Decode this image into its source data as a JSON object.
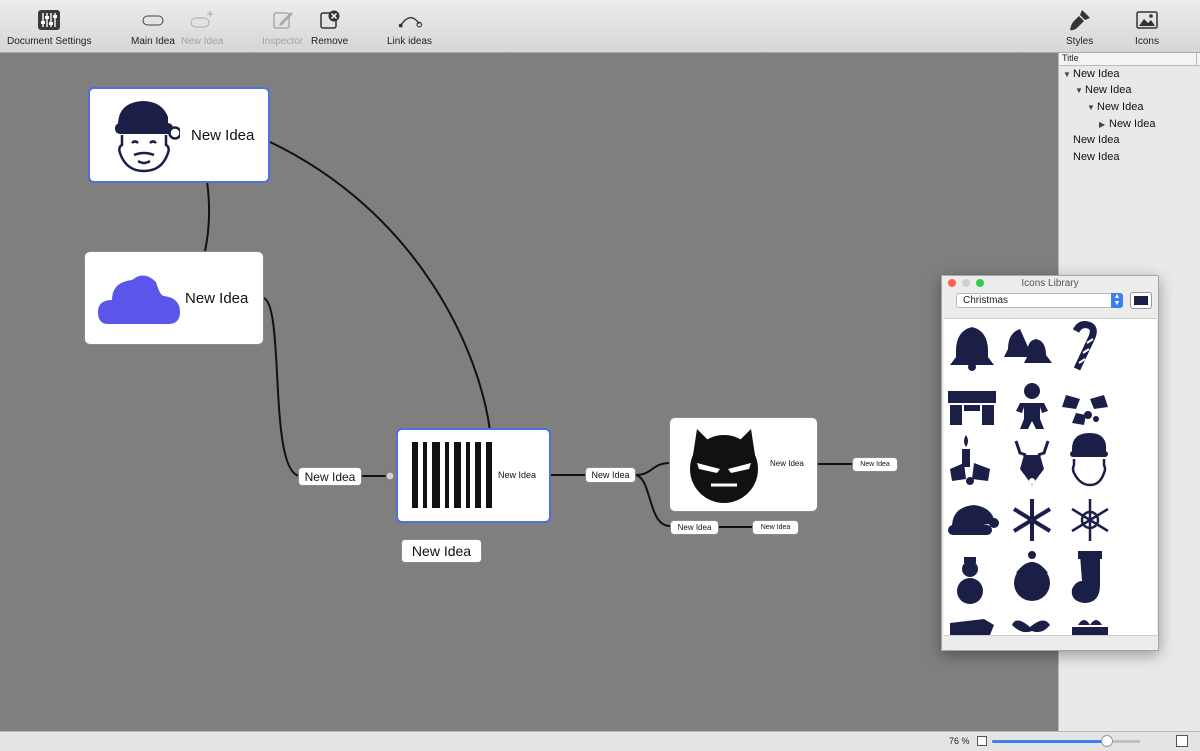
{
  "toolbar": {
    "document_settings": "Document Settings",
    "main_idea": "Main Idea",
    "new_idea": "New Idea",
    "inspector": "Inspector",
    "remove": "Remove",
    "link_ideas": "Link ideas",
    "styles": "Styles",
    "icons": "Icons"
  },
  "canvas": {
    "nodes": {
      "santa": "New Idea",
      "cloud": "New Idea",
      "barcode": "New Idea",
      "batman": "New Idea"
    },
    "pills": {
      "left": "New Idea",
      "below_barcode": "New Idea",
      "mid": "New Idea",
      "right": "New Idea",
      "bottom_a": "New Idea",
      "bottom_b": "New Idea"
    }
  },
  "outline": {
    "column_title": "Title",
    "rows": [
      "New Idea",
      "New Idea",
      "New Idea",
      "New Idea",
      "New Idea",
      "New Idea"
    ]
  },
  "status": {
    "zoom": "76 %",
    "zoom_fraction": 0.78
  },
  "icons_library": {
    "title": "Icons Library",
    "category": "Christmas",
    "icon_color": "#1b1f48",
    "icons": [
      "bell-icon",
      "bells-icon",
      "candy-cane-icon",
      "fireplace-icon",
      "gingerbread-man-icon",
      "holly-icon",
      "candle-holly-icon",
      "reindeer-icon",
      "santa-icon",
      "santa-hat-icon",
      "snowflake-icon",
      "snowflake-outline-icon",
      "snowman-icon",
      "snowman-face-icon",
      "stocking-icon",
      "sleigh-icon",
      "bow-icon",
      "gift-icon"
    ]
  },
  "colors": {
    "selection": "#4e6fe0",
    "cloud": "#5b55ea",
    "canvas": "#7f7f7f",
    "accent": "#3e7ff0"
  }
}
